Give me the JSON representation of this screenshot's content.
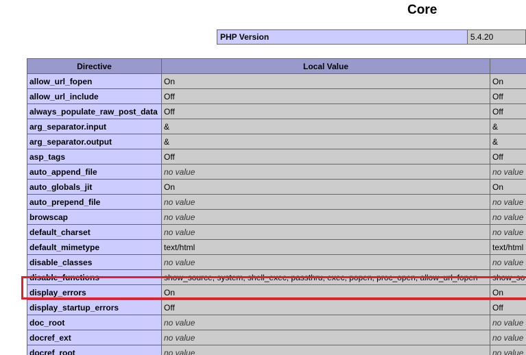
{
  "section": {
    "title": "Core"
  },
  "version": {
    "label": "PHP Version",
    "value": "5.4.20"
  },
  "table": {
    "headers": {
      "directive": "Directive",
      "local": "Local Value",
      "master": ""
    },
    "rows": [
      {
        "name": "allow_url_fopen",
        "local": "On",
        "master": "On",
        "novalue": false
      },
      {
        "name": "allow_url_include",
        "local": "Off",
        "master": "Off",
        "novalue": false
      },
      {
        "name": "always_populate_raw_post_data",
        "local": "Off",
        "master": "Off",
        "novalue": false
      },
      {
        "name": "arg_separator.input",
        "local": "&",
        "master": "&",
        "novalue": false
      },
      {
        "name": "arg_separator.output",
        "local": "&",
        "master": "&",
        "novalue": false
      },
      {
        "name": "asp_tags",
        "local": "Off",
        "master": "Off",
        "novalue": false
      },
      {
        "name": "auto_append_file",
        "local": "no value",
        "master": "no value",
        "novalue": true
      },
      {
        "name": "auto_globals_jit",
        "local": "On",
        "master": "On",
        "novalue": false
      },
      {
        "name": "auto_prepend_file",
        "local": "no value",
        "master": "no value",
        "novalue": true
      },
      {
        "name": "browscap",
        "local": "no value",
        "master": "no value",
        "novalue": true
      },
      {
        "name": "default_charset",
        "local": "no value",
        "master": "no value",
        "novalue": true
      },
      {
        "name": "default_mimetype",
        "local": "text/html",
        "master": "text/html",
        "novalue": false
      },
      {
        "name": "disable_classes",
        "local": "no value",
        "master": "no value",
        "novalue": true
      },
      {
        "name": "disable_functions",
        "local": "show_source, system, shell_exec, passthru, exec, popen, proc_open, allow_url_fopen",
        "master": "show_so",
        "novalue": false
      },
      {
        "name": "display_errors",
        "local": "On",
        "master": "On",
        "novalue": false
      },
      {
        "name": "display_startup_errors",
        "local": "Off",
        "master": "Off",
        "novalue": false
      },
      {
        "name": "doc_root",
        "local": "no value",
        "master": "no value",
        "novalue": true
      },
      {
        "name": "docref_ext",
        "local": "no value",
        "master": "no value",
        "novalue": true
      },
      {
        "name": "docref_root",
        "local": "no value",
        "master": "no value",
        "novalue": true
      }
    ]
  },
  "colors": {
    "header_bg": "#9999cc",
    "directive_bg": "#ccccff",
    "value_bg": "#cccccc",
    "highlight": "#e0212b"
  }
}
